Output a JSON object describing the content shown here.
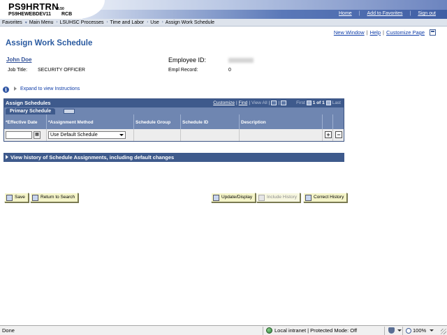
{
  "header": {
    "app_title": "PS9HRTRN",
    "app_version": "8.50",
    "app_instance": "PS9HEWEBDEV11",
    "app_user": "RCB",
    "links": [
      "Home",
      "Add to Favorites",
      "Sign out"
    ]
  },
  "breadcrumb": [
    "Favorites",
    "Main Menu",
    "LSUHSC Processes",
    "Time and Labor",
    "Use",
    "Assign Work Schedule"
  ],
  "toplinks": {
    "new_window": "New Window",
    "help": "Help",
    "customize_page": "Customize Page"
  },
  "page_title": "Assign Work Schedule",
  "employee": {
    "name": "John Doe",
    "job_title_label": "Job Title:",
    "job_title": "SECURITY OFFICER",
    "employee_id_label": "Employee ID:",
    "empl_record_label": "Empl Record:",
    "empl_record": "0"
  },
  "instructions_link": "Expand to view Instructions",
  "grid": {
    "title": "Assign Schedules",
    "nav": {
      "customize": "Customize",
      "find": "Find",
      "view_all": "View All",
      "first": "First",
      "range": "1 of 1",
      "last": "Last"
    },
    "tab": "Primary Schedule",
    "columns": [
      "*Effective Date",
      "*Assignment Method",
      "Schedule Group",
      "Schedule ID",
      "Description"
    ],
    "row": {
      "effective_date": "",
      "assignment_method": "Use Default Schedule"
    }
  },
  "history_bar": "View history of Schedule Assignments, including default changes",
  "buttons": {
    "save": "Save",
    "return_to_search": "Return to Search",
    "update_display": "Update/Display",
    "include_history": "Include History",
    "correct_history": "Correct History"
  },
  "status_bar": {
    "done": "Done",
    "zone": "Local intranet | Protected Mode: Off",
    "zoom": "100%"
  }
}
